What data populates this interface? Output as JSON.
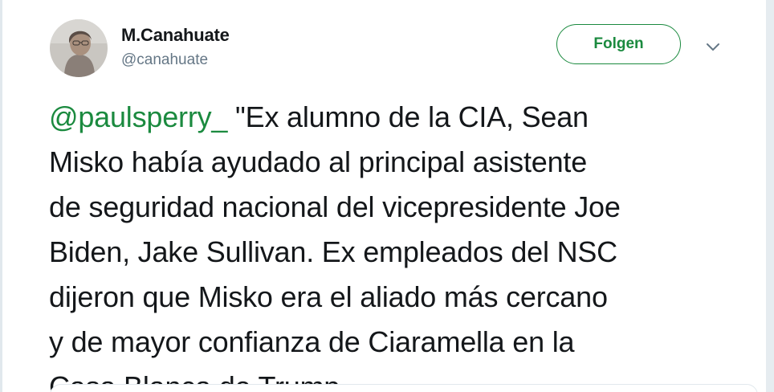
{
  "author": {
    "display_name": "M.Canahuate",
    "handle": "@canahuate",
    "avatar_icon": "profile-photo-icon"
  },
  "actions": {
    "follow_label": "Folgen",
    "more_icon": "chevron-down-icon"
  },
  "tweet": {
    "mention": "@paulsperry_",
    "body": "  \"Ex alumno de la CIA, Sean\nMisko había ayudado  al principal asistente\nde seguridad nacional del vicepresidente Joe\nBiden, Jake Sullivan. Ex empleados del NSC\ndijeron que Misko era el aliado más cercano\ny de mayor confianza de Ciaramella en la\nCasa Blanca de Trump."
  },
  "colors": {
    "accent": "#1b8a3f",
    "text": "#14171a",
    "secondary_text": "#657786",
    "border": "#e1e8ed"
  }
}
